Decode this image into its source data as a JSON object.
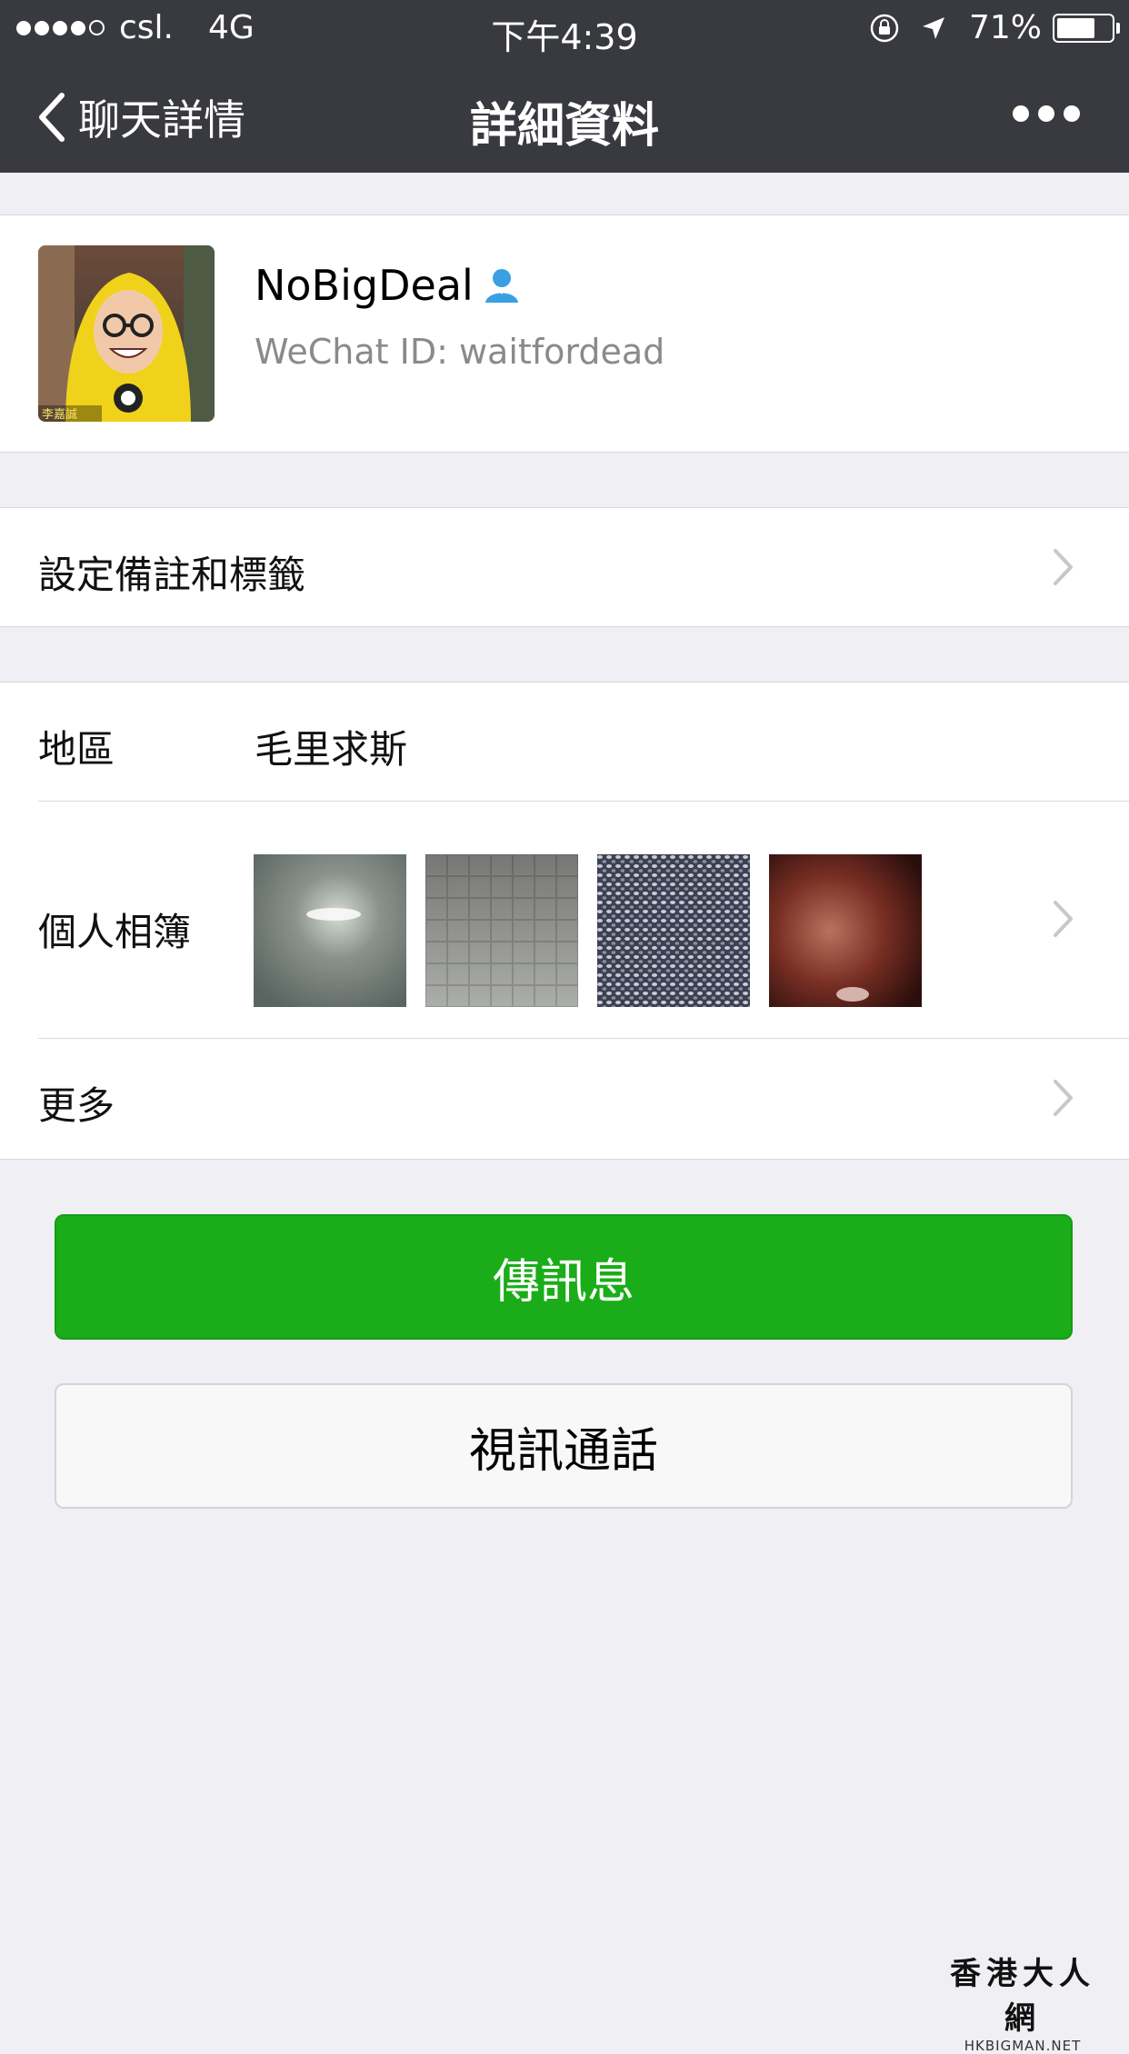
{
  "status_bar": {
    "carrier": "csl.",
    "network": "4G",
    "time": "下午4:39",
    "battery": "71%",
    "battery_level": 0.71
  },
  "nav": {
    "back_label": "聊天詳情",
    "title": "詳細資料",
    "more_icon": "ellipsis-icon"
  },
  "profile": {
    "name": "NoBigDeal",
    "wechat_id": "WeChat ID: waitfordead",
    "avatar_caption": "李嘉誠"
  },
  "remark": {
    "label": "設定備註和標籤"
  },
  "info": {
    "region_label": "地區",
    "region_value": "毛里求斯",
    "album_label": "個人相簿",
    "more_label": "更多"
  },
  "buttons": {
    "message": "傳訊息",
    "video_call": "視訊通話"
  },
  "watermark": {
    "main": "香港大人網",
    "sub": "HKBIGMAN.NET"
  },
  "colors": {
    "nav_bg": "#393a3f",
    "primary_green": "#1aad19",
    "page_bg": "#efeff4"
  }
}
